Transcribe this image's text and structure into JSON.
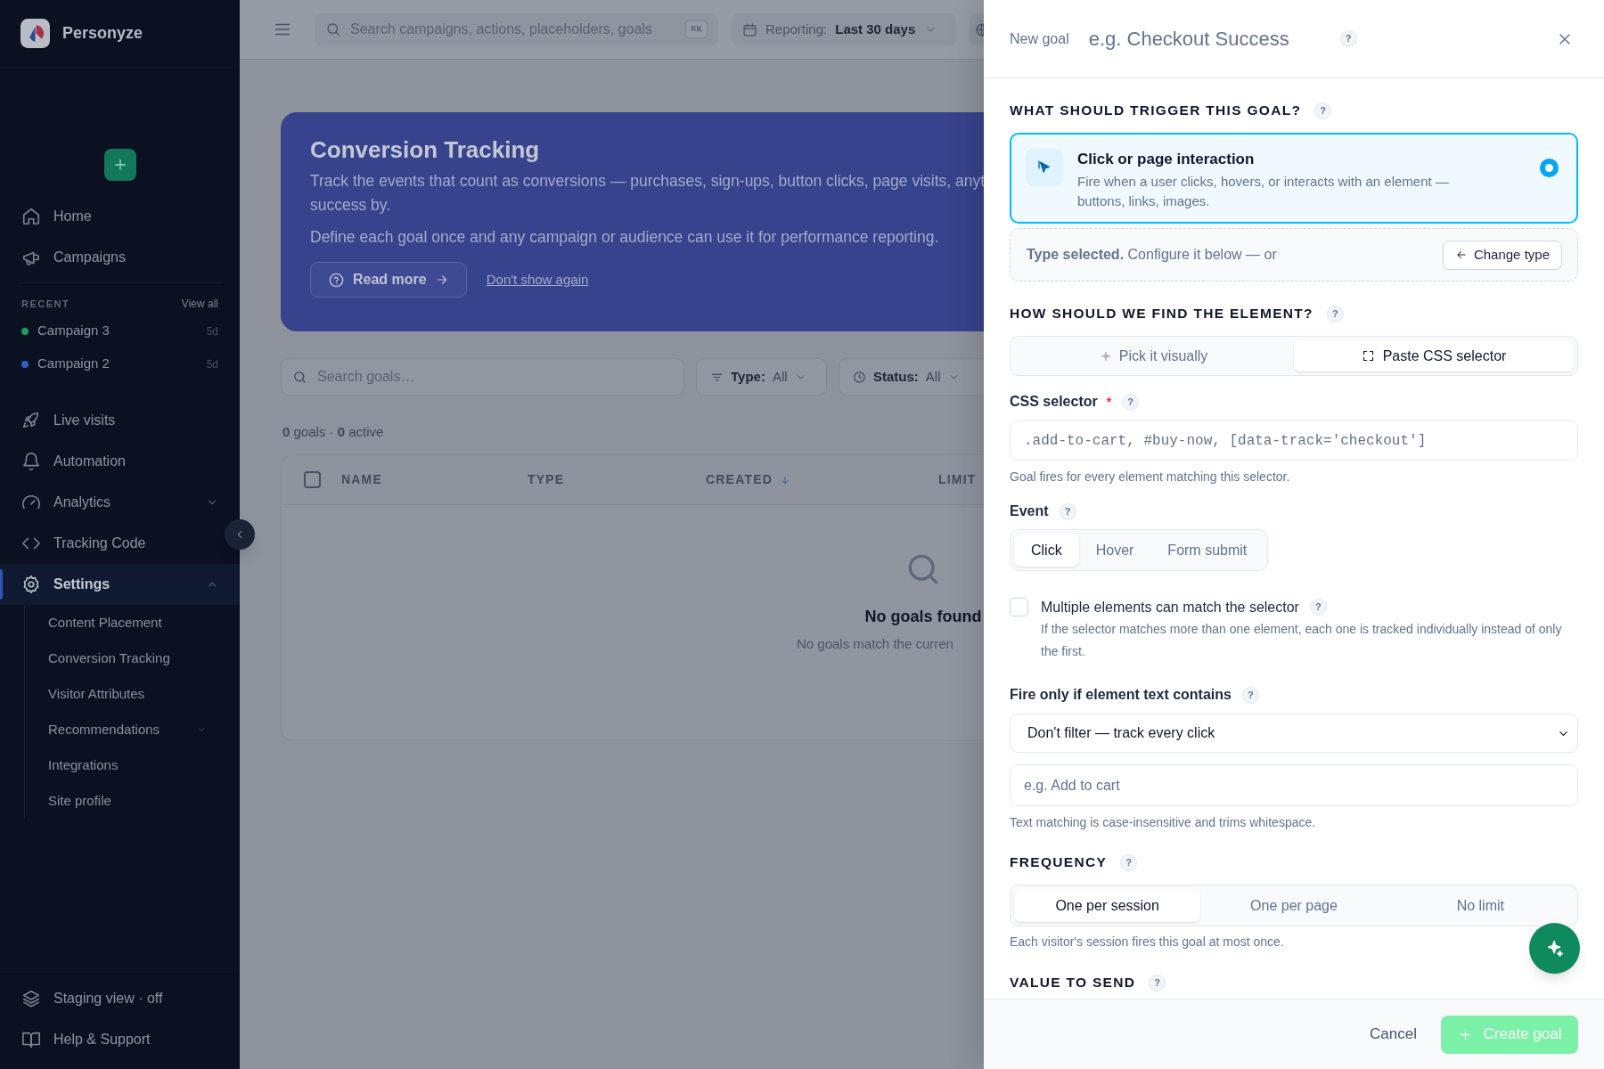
{
  "sidebar": {
    "brand": "Personyze",
    "top_nav": [
      {
        "label": "Home",
        "selected": false
      },
      {
        "label": "Campaigns",
        "selected": false
      }
    ],
    "recent": {
      "title": "RECENT",
      "link": "View all",
      "items": [
        {
          "label": "Campaign 3",
          "age": "5d",
          "color": "#16a05c"
        },
        {
          "label": "Campaign 2",
          "age": "5d",
          "color": "#2f5fc4"
        }
      ]
    },
    "main_nav": [
      {
        "label": "Live visits",
        "selected": false
      },
      {
        "label": "Automation",
        "selected": false
      },
      {
        "label": "Analytics",
        "selected": false,
        "expanded": false
      },
      {
        "label": "Tracking Code",
        "selected": false
      },
      {
        "label": "Settings",
        "selected": true,
        "expanded": true,
        "children": [
          {
            "label": "Content Placement"
          },
          {
            "label": "Conversion Tracking"
          },
          {
            "label": "Visitor Attributes"
          },
          {
            "label": "Recommendations",
            "expanded": false
          },
          {
            "label": "Integrations"
          },
          {
            "label": "Site profile"
          }
        ]
      }
    ],
    "bottom_nav": [
      {
        "label": "Staging view · off"
      },
      {
        "label": "Help & Support"
      }
    ]
  },
  "topbar": {
    "search_placeholder": "Search campaigns, actions, placeholders, goals",
    "shortcut": "⌘K",
    "reporting_label": "Reporting:",
    "reporting_value": "Last 30 days"
  },
  "banner": {
    "title": "Conversion Tracking",
    "lines": [
      "Track the events that count as conversions — purchases, sign-ups, button clicks, page visits, anyt",
      "success by."
    ],
    "secondary": "Define each goal once and any campaign or audience can use it for performance reporting.",
    "read_more": "Read more",
    "dismiss": "Don't show again"
  },
  "filters": {
    "search_placeholder": "Search goals…",
    "type_label": "Type:",
    "type_value": "All",
    "status_label": "Status:",
    "status_value": "All"
  },
  "summary": "**0** goals · **0** active",
  "table": {
    "select_all_checked": false,
    "columns": [
      {
        "label": "NAME",
        "sorted": false
      },
      {
        "label": "TYPE",
        "sorted": false
      },
      {
        "label": "CREATED",
        "sorted": true
      },
      {
        "label": "LIMIT",
        "sorted": false
      }
    ],
    "empty_title": "No goals found",
    "empty_text": "No goals match the curren"
  },
  "drawer": {
    "label": "New goal",
    "name_placeholder": "e.g. Checkout Success",
    "help": "?",
    "trigger": {
      "heading": "WHAT SHOULD TRIGGER THIS GOAL?",
      "help": "?",
      "option": {
        "title": "Click or page interaction",
        "description": "Fire when a user clicks, hovers, or interacts with an element — buttons, links, images.",
        "selected": true
      },
      "confirm": "**Type selected.** Configure it below — or",
      "change_button": "Change type"
    },
    "finder": {
      "heading": "HOW SHOULD WE FIND THE ELEMENT?",
      "help": "?",
      "tabs": [
        {
          "label": "Pick it visually",
          "selected": false
        },
        {
          "label": "Paste CSS selector",
          "selected": true
        }
      ]
    },
    "selector": {
      "label": "CSS selector",
      "required": true,
      "required_mark": "*",
      "help": "?",
      "placeholder": ".add-to-cart, #buy-now, [data-track='checkout']",
      "hint": "Goal fires for every element matching this selector."
    },
    "event": {
      "label": "Event",
      "help": "?",
      "options": [
        {
          "label": "Click",
          "selected": true
        },
        {
          "label": "Hover",
          "selected": false
        },
        {
          "label": "Form submit",
          "selected": false
        }
      ]
    },
    "multiple": {
      "label": "Multiple elements can match the selector",
      "help": "?",
      "checked": false,
      "description": "If the selector matches more than one element, each one is tracked individually instead of only the first."
    },
    "text_filter": {
      "label": "Fire only if element text contains",
      "help": "?",
      "select_value": "Don't filter — track every click",
      "placeholder": "e.g. Add to cart",
      "hint": "Text matching is case-insensitive and trims whitespace."
    },
    "frequency": {
      "heading": "FREQUENCY",
      "help": "?",
      "options": [
        {
          "label": "One per session",
          "selected": true
        },
        {
          "label": "One per page",
          "selected": false
        },
        {
          "label": "No limit",
          "selected": false
        }
      ],
      "hint": "Each visitor's session fires this goal at most once."
    },
    "value": {
      "heading": "VALUE TO SEND",
      "help": "?"
    },
    "footer": {
      "cancel": "Cancel",
      "submit": "Create goal",
      "submit_disabled": true
    }
  }
}
